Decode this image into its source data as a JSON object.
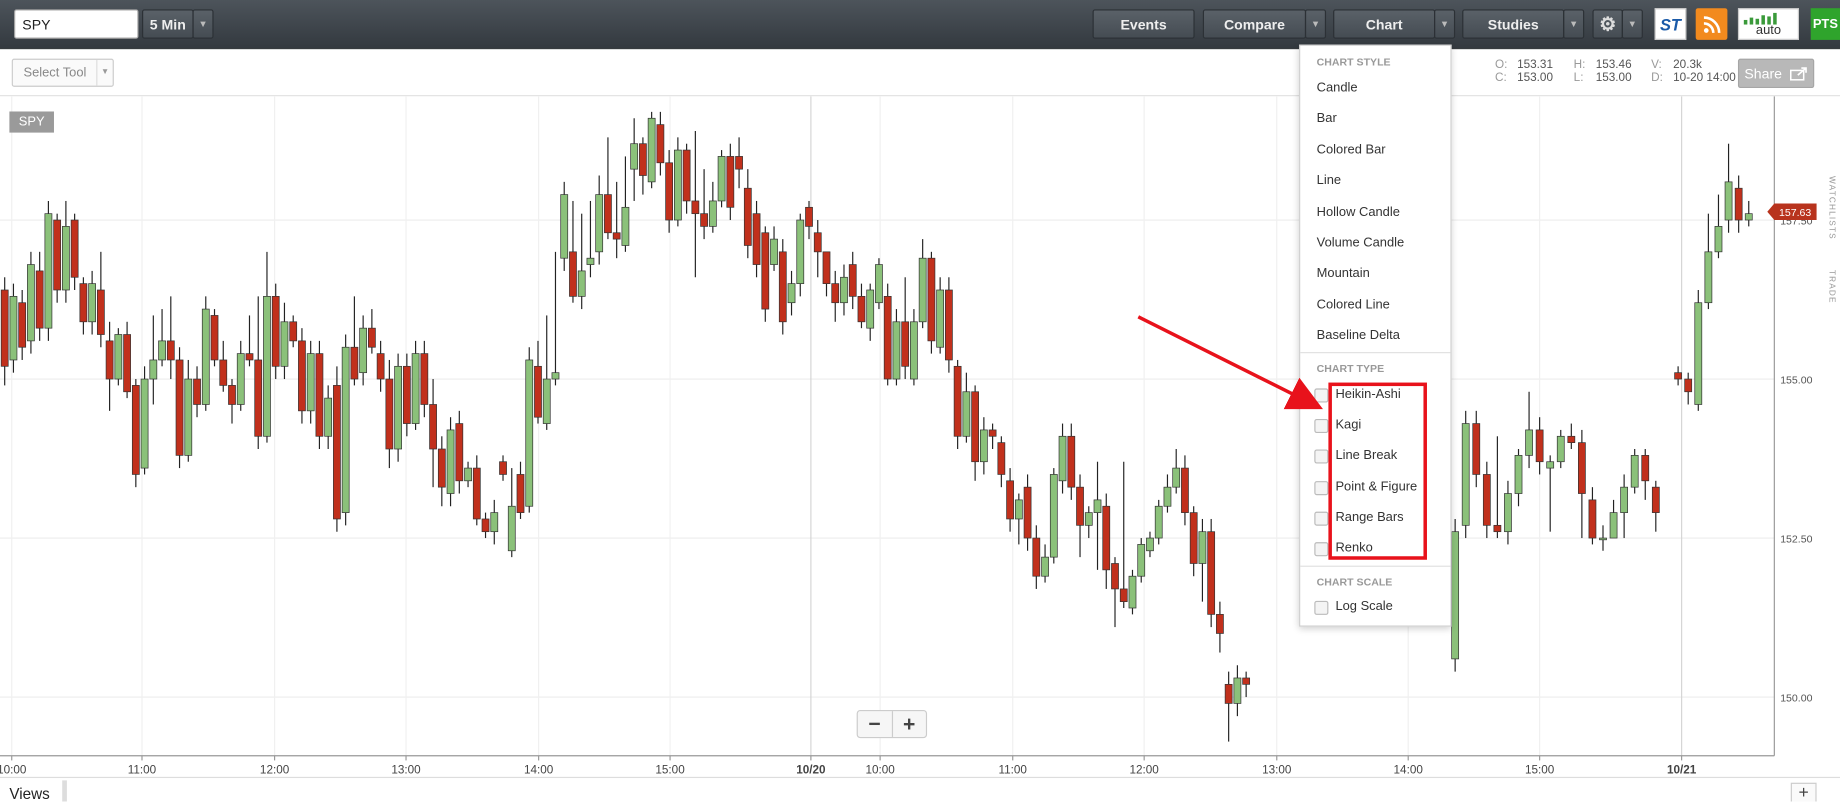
{
  "toolbar": {
    "symbol_value": "SPY",
    "interval_label": "5 Min",
    "events_label": "Events",
    "compare_label": "Compare",
    "chart_label": "Chart",
    "studies_label": "Studies",
    "st_logo": "ST",
    "auto_logo": "auto",
    "pts_logo": "PTS"
  },
  "toolbar2": {
    "select_tool": "Select Tool",
    "ohlc": {
      "o_key": "O:",
      "o_val": "153.31",
      "c_key": "C:",
      "c_val": "153.00",
      "h_key": "H:",
      "h_val": "153.46",
      "l_key": "L:",
      "l_val": "153.00",
      "v_key": "V:",
      "v_val": "20.3k",
      "d_key": "D:",
      "d_val": "10-20 14:00"
    },
    "share_label": "Share"
  },
  "chart_symbol_label": "SPY",
  "menu": {
    "chart_style_header": "CHART STYLE",
    "styles": [
      "Candle",
      "Bar",
      "Colored Bar",
      "Line",
      "Hollow Candle",
      "Volume Candle",
      "Mountain",
      "Colored Line",
      "Baseline Delta"
    ],
    "chart_type_header": "CHART TYPE",
    "types": [
      "Heikin-Ashi",
      "Kagi",
      "Line Break",
      "Point & Figure",
      "Range Bars",
      "Renko"
    ],
    "chart_scale_header": "CHART SCALE",
    "scale_option": "Log Scale"
  },
  "bottom": {
    "views_label": "Views",
    "plus_label": "+"
  },
  "side_tabs": {
    "watchlists": "WATCHLISTS",
    "trade": "TRADE"
  },
  "zoom": {
    "minus": "−",
    "plus": "+"
  },
  "colors": {
    "up": "#8bc17a",
    "down": "#c1301c",
    "price_tag": "#b8331d",
    "annotation": "#e8121b"
  },
  "chart_data": {
    "type": "candlestick",
    "symbol": "SPY",
    "interval": "5 Min",
    "ylim": [
      149.2,
      159.6
    ],
    "y_ticks": [
      "150.00",
      "152.50",
      "155.00",
      "157.50"
    ],
    "last_price": "157.63",
    "x_ticks": [
      "10:00",
      "11:00",
      "12:00",
      "13:00",
      "14:00",
      "15:00",
      "10/20",
      "10:00",
      "11:00",
      "12:00",
      "13:00",
      "14:00",
      "15:00",
      "10/21"
    ],
    "candles": [
      [
        156.4,
        155.2,
        156.6,
        154.9
      ],
      [
        155.3,
        156.3,
        156.5,
        155.1
      ],
      [
        156.2,
        155.5,
        156.4,
        155.3
      ],
      [
        155.6,
        156.8,
        157.0,
        155.4
      ],
      [
        156.7,
        155.8,
        157.0,
        155.6
      ],
      [
        155.8,
        157.6,
        157.8,
        155.6
      ],
      [
        157.5,
        156.4,
        157.6,
        156.2
      ],
      [
        156.4,
        157.4,
        157.8,
        156.2
      ],
      [
        157.5,
        156.6,
        157.6,
        156.4
      ],
      [
        156.5,
        155.9,
        156.6,
        155.7
      ],
      [
        155.9,
        156.5,
        156.7,
        155.7
      ],
      [
        156.4,
        155.7,
        157.0,
        155.5
      ],
      [
        155.6,
        155.0,
        155.9,
        154.5
      ],
      [
        155.0,
        155.7,
        155.8,
        154.9
      ],
      [
        155.7,
        154.8,
        155.9,
        154.7
      ],
      [
        154.9,
        153.5,
        155.0,
        153.3
      ],
      [
        153.6,
        155.0,
        155.2,
        153.5
      ],
      [
        155.0,
        155.3,
        156.0,
        154.6
      ],
      [
        155.3,
        155.6,
        156.1,
        155.2
      ],
      [
        155.6,
        155.3,
        156.3,
        155.0
      ],
      [
        155.3,
        153.8,
        155.5,
        153.6
      ],
      [
        153.8,
        155.0,
        155.3,
        153.7
      ],
      [
        155.0,
        154.6,
        155.2,
        154.4
      ],
      [
        154.6,
        156.1,
        156.3,
        154.5
      ],
      [
        156.0,
        155.3,
        156.1,
        155.2
      ],
      [
        155.3,
        154.9,
        155.6,
        154.8
      ],
      [
        154.9,
        154.6,
        155.0,
        154.3
      ],
      [
        154.6,
        155.4,
        155.6,
        154.5
      ],
      [
        155.4,
        155.3,
        156.0,
        155.2
      ],
      [
        155.3,
        154.1,
        156.3,
        153.9
      ],
      [
        154.1,
        156.3,
        157.0,
        154.0
      ],
      [
        156.3,
        155.2,
        156.5,
        155.0
      ],
      [
        155.2,
        155.9,
        156.2,
        155.0
      ],
      [
        155.9,
        155.6,
        156.0,
        155.5
      ],
      [
        155.6,
        154.5,
        155.8,
        154.3
      ],
      [
        154.5,
        155.4,
        155.6,
        154.3
      ],
      [
        155.4,
        154.1,
        155.6,
        153.9
      ],
      [
        154.1,
        154.7,
        154.9,
        153.9
      ],
      [
        154.9,
        152.8,
        155.2,
        152.6
      ],
      [
        152.9,
        155.5,
        155.7,
        152.7
      ],
      [
        155.5,
        155.0,
        156.3,
        154.9
      ],
      [
        155.1,
        155.8,
        156.0,
        154.9
      ],
      [
        155.8,
        155.5,
        156.1,
        155.4
      ],
      [
        155.4,
        155.0,
        155.6,
        154.8
      ],
      [
        155.0,
        153.9,
        155.3,
        153.6
      ],
      [
        153.9,
        155.2,
        155.4,
        153.7
      ],
      [
        155.2,
        154.3,
        155.4,
        154.1
      ],
      [
        154.3,
        155.4,
        155.6,
        154.2
      ],
      [
        155.4,
        154.6,
        155.6,
        154.4
      ],
      [
        154.6,
        153.9,
        155.0,
        153.3
      ],
      [
        153.9,
        153.3,
        154.1,
        153.0
      ],
      [
        153.2,
        154.2,
        154.4,
        153.0
      ],
      [
        154.3,
        153.4,
        154.5,
        153.2
      ],
      [
        153.4,
        153.6,
        153.7,
        153.3
      ],
      [
        153.6,
        152.8,
        153.8,
        152.7
      ],
      [
        152.8,
        152.6,
        152.9,
        152.5
      ],
      [
        152.6,
        152.9,
        153.1,
        152.4
      ],
      [
        153.7,
        153.5,
        153.8,
        153.4
      ],
      [
        152.3,
        153.0,
        153.6,
        152.2
      ],
      [
        153.5,
        152.9,
        153.7,
        152.8
      ],
      [
        153.0,
        155.3,
        155.5,
        152.9
      ],
      [
        155.2,
        154.4,
        155.6,
        154.3
      ],
      [
        154.3,
        155.0,
        156.0,
        154.2
      ],
      [
        155.0,
        155.1,
        157.0,
        154.9
      ],
      [
        156.9,
        157.9,
        158.1,
        156.7
      ],
      [
        157.0,
        156.3,
        157.8,
        156.2
      ],
      [
        156.3,
        156.7,
        157.6,
        156.1
      ],
      [
        156.8,
        156.9,
        157.8,
        156.6
      ],
      [
        157.0,
        157.9,
        158.2,
        156.8
      ],
      [
        157.9,
        157.3,
        158.8,
        157.2
      ],
      [
        157.3,
        157.2,
        158.1,
        156.9
      ],
      [
        157.1,
        157.7,
        158.5,
        157.0
      ],
      [
        158.3,
        158.7,
        159.1,
        157.8
      ],
      [
        158.7,
        158.2,
        158.8,
        157.9
      ],
      [
        158.1,
        159.1,
        159.2,
        158.0
      ],
      [
        159.0,
        158.4,
        159.2,
        158.2
      ],
      [
        158.4,
        157.5,
        158.6,
        157.3
      ],
      [
        157.5,
        158.6,
        158.8,
        157.4
      ],
      [
        158.6,
        157.8,
        158.7,
        157.6
      ],
      [
        157.8,
        157.6,
        158.9,
        156.6
      ],
      [
        157.6,
        157.4,
        158.3,
        157.2
      ],
      [
        157.4,
        157.8,
        158.1,
        157.3
      ],
      [
        157.8,
        158.5,
        158.6,
        157.7
      ],
      [
        158.5,
        157.7,
        158.7,
        157.5
      ],
      [
        158.5,
        158.3,
        158.8,
        158.0
      ],
      [
        158.0,
        157.1,
        158.3,
        156.9
      ],
      [
        157.6,
        156.8,
        157.8,
        156.6
      ],
      [
        157.3,
        156.1,
        157.4,
        155.9
      ],
      [
        156.8,
        157.2,
        157.4,
        156.7
      ],
      [
        157.0,
        155.9,
        157.2,
        155.7
      ],
      [
        156.2,
        156.5,
        156.7,
        156.0
      ],
      [
        156.5,
        157.5,
        157.6,
        156.3
      ],
      [
        157.7,
        157.4,
        157.8,
        157.2
      ],
      [
        157.3,
        157.0,
        157.5,
        156.6
      ],
      [
        157.0,
        156.5,
        157.0,
        156.3
      ],
      [
        156.5,
        156.2,
        156.7,
        155.9
      ],
      [
        156.2,
        156.6,
        156.8,
        156.0
      ],
      [
        156.8,
        156.3,
        157.0,
        156.1
      ],
      [
        156.3,
        155.9,
        156.5,
        155.8
      ],
      [
        155.8,
        156.4,
        156.5,
        155.6
      ],
      [
        156.2,
        156.8,
        156.9,
        156.1
      ],
      [
        156.3,
        155.0,
        156.5,
        154.9
      ],
      [
        155.0,
        155.9,
        156.1,
        154.9
      ],
      [
        155.9,
        155.2,
        156.6,
        155.0
      ],
      [
        155.0,
        155.9,
        156.1,
        154.9
      ],
      [
        155.9,
        156.9,
        157.2,
        155.8
      ],
      [
        156.9,
        155.6,
        157.0,
        155.4
      ],
      [
        155.5,
        156.4,
        156.6,
        155.4
      ],
      [
        156.4,
        155.3,
        156.6,
        155.1
      ],
      [
        155.2,
        154.1,
        155.3,
        153.9
      ],
      [
        154.1,
        154.8,
        155.1,
        154.0
      ],
      [
        154.8,
        153.7,
        154.9,
        153.4
      ],
      [
        153.7,
        154.2,
        154.4,
        153.5
      ],
      [
        154.2,
        154.1,
        154.3,
        153.9
      ],
      [
        154.0,
        153.5,
        154.1,
        153.3
      ],
      [
        153.4,
        152.8,
        153.6,
        152.6
      ],
      [
        152.8,
        153.1,
        153.2,
        152.4
      ],
      [
        153.3,
        152.5,
        153.5,
        152.3
      ],
      [
        152.5,
        151.9,
        152.7,
        151.7
      ],
      [
        151.9,
        152.2,
        152.4,
        151.8
      ],
      [
        152.2,
        153.5,
        153.6,
        152.1
      ],
      [
        153.4,
        154.1,
        154.3,
        153.2
      ],
      [
        154.1,
        153.3,
        154.3,
        153.1
      ],
      [
        153.3,
        152.7,
        153.5,
        152.2
      ],
      [
        152.7,
        152.9,
        153.0,
        152.5
      ],
      [
        152.9,
        153.1,
        153.7,
        152.0
      ],
      [
        153.0,
        152.0,
        153.2,
        151.7
      ],
      [
        152.1,
        151.7,
        152.2,
        151.1
      ],
      [
        151.7,
        151.5,
        153.7,
        151.4
      ],
      [
        151.4,
        151.9,
        152.0,
        151.3
      ],
      [
        151.9,
        152.4,
        152.5,
        151.8
      ],
      [
        152.3,
        152.5,
        152.6,
        152.2
      ],
      [
        152.5,
        153.0,
        153.1,
        152.4
      ],
      [
        153.0,
        153.3,
        153.5,
        152.9
      ],
      [
        153.3,
        153.6,
        153.9,
        153.2
      ],
      [
        153.6,
        152.9,
        153.8,
        152.7
      ],
      [
        152.9,
        152.1,
        153.0,
        151.9
      ],
      [
        152.1,
        152.6,
        152.8,
        151.5
      ],
      [
        152.6,
        151.3,
        152.8,
        151.1
      ],
      [
        151.3,
        151.0,
        151.5,
        150.7
      ],
      [
        150.2,
        149.9,
        150.4,
        149.3
      ],
      [
        149.9,
        150.3,
        150.5,
        149.7
      ],
      [
        150.3,
        150.2,
        150.4,
        150.0
      ]
    ],
    "candles_right": [
      [
        150.6,
        152.6,
        152.8,
        150.4
      ],
      [
        152.7,
        154.3,
        154.5,
        152.5
      ],
      [
        154.3,
        153.5,
        154.5,
        153.3
      ],
      [
        153.5,
        152.7,
        153.7,
        152.5
      ],
      [
        152.7,
        152.6,
        154.1,
        152.5
      ],
      [
        152.6,
        153.2,
        153.4,
        152.4
      ],
      [
        153.2,
        153.8,
        153.9,
        153.0
      ],
      [
        153.8,
        154.2,
        154.8,
        153.6
      ],
      [
        154.2,
        153.7,
        154.4,
        153.5
      ],
      [
        153.6,
        153.7,
        153.8,
        152.6
      ],
      [
        153.7,
        154.1,
        154.2,
        153.6
      ],
      [
        154.1,
        154.0,
        154.3,
        153.9
      ],
      [
        154.0,
        153.2,
        154.2,
        152.5
      ],
      [
        153.1,
        152.5,
        153.3,
        152.4
      ],
      [
        152.5,
        152.5,
        152.7,
        152.3
      ],
      [
        152.5,
        152.9,
        153.1,
        152.7
      ],
      [
        152.9,
        153.3,
        153.5,
        152.5
      ],
      [
        153.3,
        153.8,
        153.9,
        153.2
      ],
      [
        153.8,
        153.4,
        153.9,
        153.1
      ],
      [
        153.3,
        152.9,
        153.4,
        152.6
      ]
    ]
  }
}
